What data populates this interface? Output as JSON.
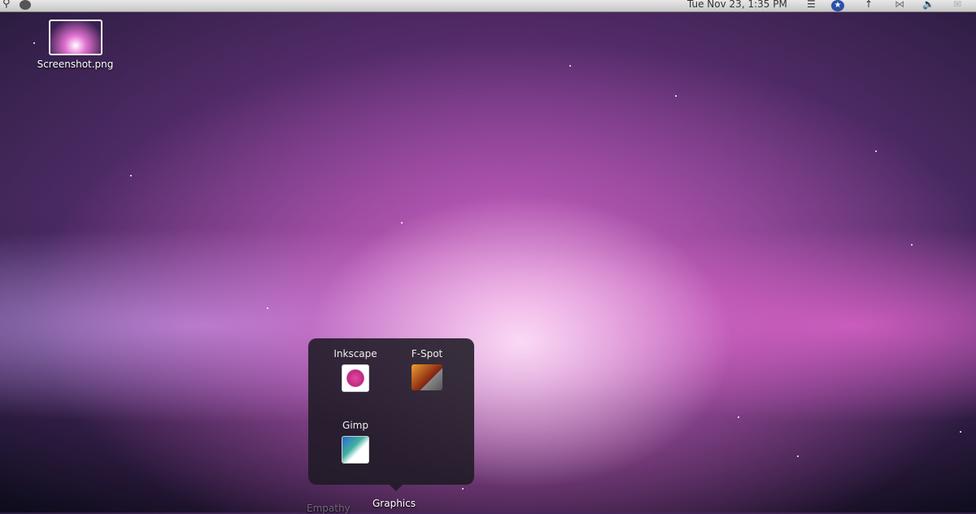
{
  "topbar": {
    "clock": "Tue Nov 23,  1:35 PM",
    "icons": [
      "search-icon",
      "apple-icon",
      "wifi-icon",
      "accessibility-icon",
      "network-icon",
      "bluetooth-icon",
      "volume-icon",
      "mail-icon"
    ]
  },
  "desktop": {
    "file_label": "Screenshot.png"
  },
  "stack": {
    "title": "Graphics",
    "apps": [
      {
        "label": "Inkscape"
      },
      {
        "label": "F-Spot"
      },
      {
        "label": "Gimp"
      }
    ]
  },
  "dock": {
    "faded_label": "Empathy"
  }
}
